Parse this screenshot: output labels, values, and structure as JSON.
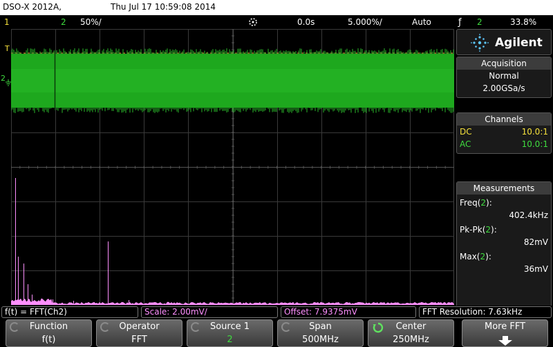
{
  "title_bar": {
    "model": "DSO-X 2012A,",
    "datetime": "Thu Jul 17 10:59:08 2014"
  },
  "status_bar": {
    "ch1_num": "1",
    "ch2_num": "2",
    "ch2_scale": "50%/",
    "trigger_icon": "trigger-position-icon",
    "delay": "0.0s",
    "timebase": "5.000%/",
    "trigger_mode": "Auto",
    "trigger_source": "2",
    "trigger_level": "33.8%",
    "colors": {
      "ch1": "#f5e03c",
      "ch2": "#3fdc3f",
      "math": "#ff8fff",
      "orange": "#ff9a3c"
    }
  },
  "screen_markers": {
    "trig_level_marker": "T",
    "ch2_marker": "2"
  },
  "side_panel": {
    "brand": "Agilent",
    "acquisition": {
      "header": "Acquisition",
      "mode": "Normal",
      "rate": "2.00GSa/s"
    },
    "channels": {
      "header": "Channels",
      "rows": [
        {
          "coupling": "DC",
          "ratio": "10.0:1",
          "color": "#f5e03c"
        },
        {
          "coupling": "AC",
          "ratio": "10.0:1",
          "color": "#3fdc3f"
        }
      ]
    },
    "measurements": {
      "header": "Measurements",
      "items": [
        {
          "label_prefix": "Freq(",
          "channel": "2",
          "label_suffix": "):",
          "value": "402.4kHz"
        },
        {
          "label_prefix": "Pk-Pk(",
          "channel": "2",
          "label_suffix": "):",
          "value": "82mV"
        },
        {
          "label_prefix": "Max(",
          "channel": "2",
          "label_suffix": "):",
          "value": "36mV"
        }
      ]
    }
  },
  "info_row": {
    "function": "f(t) = FFT(Ch2)",
    "scale": "Scale: 2.00mV/",
    "offset": "Offset: 7.9375mV",
    "resolution": "FFT Resolution: 7.63kHz"
  },
  "softkeys": [
    {
      "label": "Function",
      "value": "f(t)",
      "value_color": "#ffffff"
    },
    {
      "label": "Operator",
      "value": "FFT",
      "value_color": "#ffffff"
    },
    {
      "label": "Source 1",
      "value": "2",
      "value_color": "#3fdc3f"
    },
    {
      "label": "Span",
      "value": "500MHz",
      "value_color": "#ffffff"
    },
    {
      "label": "Center",
      "value": "250MHz",
      "value_color": "#ffffff"
    },
    {
      "label": "More FFT",
      "value": "",
      "value_color": "#ffffff"
    }
  ]
}
